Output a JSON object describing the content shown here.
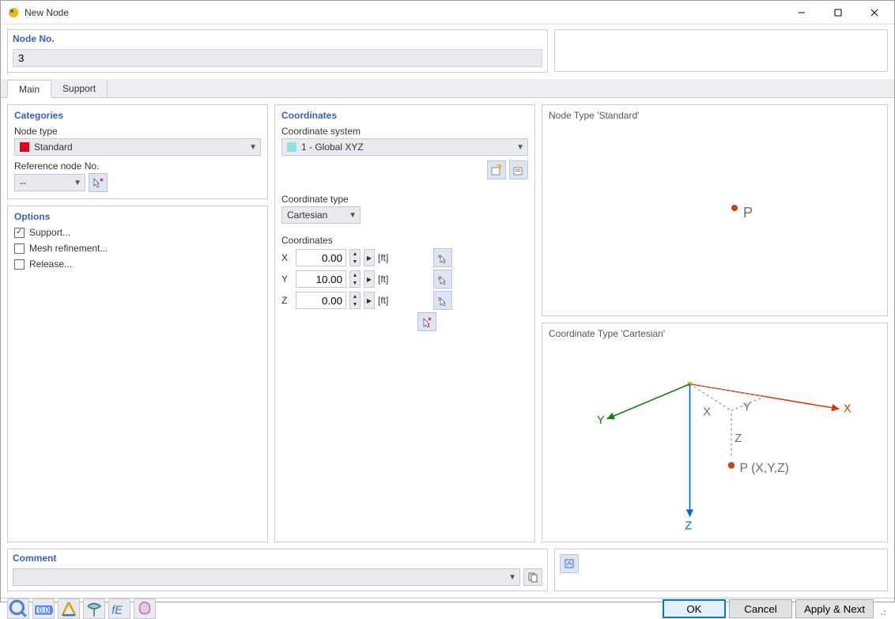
{
  "window": {
    "title": "New Node"
  },
  "node_no": {
    "label": "Node No.",
    "value": "3"
  },
  "tabs": {
    "main": "Main",
    "support": "Support",
    "active": "main"
  },
  "categories": {
    "title": "Categories",
    "node_type_label": "Node type",
    "node_type_value": "Standard",
    "node_type_color": "#e2001a",
    "ref_node_label": "Reference node No.",
    "ref_node_value": "--"
  },
  "options": {
    "title": "Options",
    "support": {
      "label": "Support...",
      "checked": true
    },
    "mesh": {
      "label": "Mesh refinement...",
      "checked": false
    },
    "release": {
      "label": "Release...",
      "checked": false
    }
  },
  "coords": {
    "title": "Coordinates",
    "system_label": "Coordinate system",
    "system_value": "1 - Global XYZ",
    "system_color": "#8de3e0",
    "type_label": "Coordinate type",
    "type_value": "Cartesian",
    "values_label": "Coordinates",
    "unit": "[ft]",
    "x": {
      "label": "X",
      "value": "0.00"
    },
    "y": {
      "label": "Y",
      "value": "10.00"
    },
    "z": {
      "label": "Z",
      "value": "0.00"
    }
  },
  "previews": {
    "node_type_title": "Node Type 'Standard'",
    "coord_type_title": "Coordinate Type 'Cartesian'",
    "p_label": "P",
    "pxyz_label": "P (X,Y,Z)",
    "axis_x": "X",
    "axis_y": "Y",
    "axis_z": "Z",
    "sx": "X",
    "sy": "Y",
    "sz": "Z"
  },
  "comment": {
    "title": "Comment",
    "value": ""
  },
  "footer": {
    "ok": "OK",
    "cancel": "Cancel",
    "apply": "Apply & Next"
  }
}
